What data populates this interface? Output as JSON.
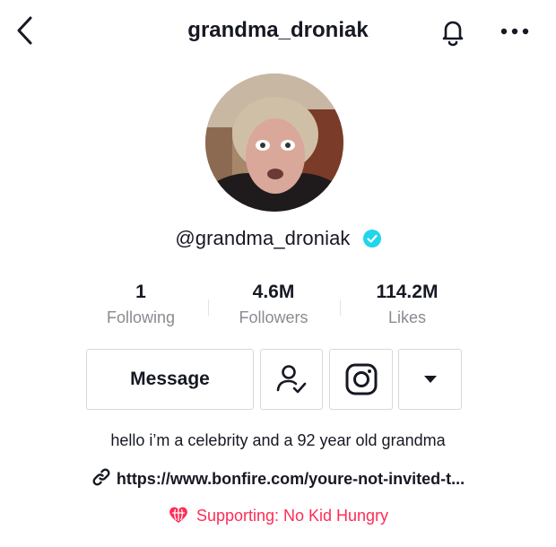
{
  "header": {
    "title": "grandma_droniak",
    "back_icon": "chevron-left-icon",
    "bell_icon": "bell-icon",
    "more_icon": "more-horizontal-icon"
  },
  "profile": {
    "username": "@grandma_droniak",
    "verified": true,
    "verified_color": "#20d5ec"
  },
  "stats": [
    {
      "value": "1",
      "label": "Following"
    },
    {
      "value": "4.6M",
      "label": "Followers"
    },
    {
      "value": "114.2M",
      "label": "Likes"
    }
  ],
  "actions": {
    "message_label": "Message",
    "follow_icon": "user-check-icon",
    "instagram_icon": "instagram-icon",
    "dropdown_icon": "caret-down-icon"
  },
  "bio": "hello i’m a celebrity and a 92 year old grandma",
  "link": {
    "text": "https://www.bonfire.com/youre-not-invited-t...",
    "icon": "link-icon"
  },
  "supporting": {
    "text": "Supporting: No Kid Hungry",
    "icon": "globe-heart-icon",
    "color": "#fe2c55"
  }
}
